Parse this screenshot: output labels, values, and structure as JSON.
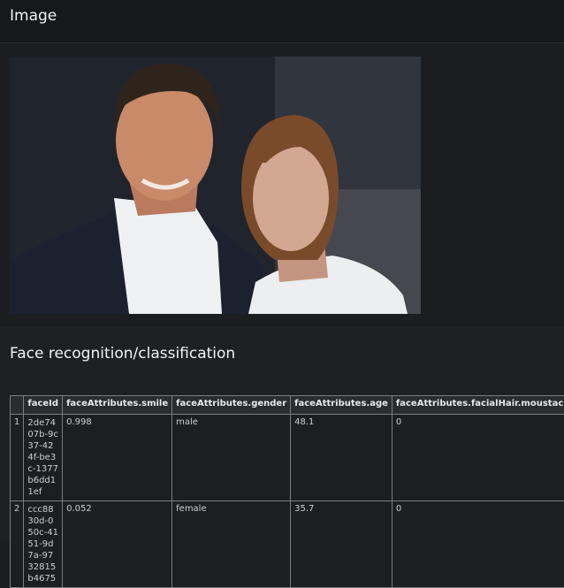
{
  "image_section": {
    "title": "Image"
  },
  "photo": {
    "description_icon": "portrait-photo"
  },
  "face_section": {
    "title": "Face recognition/classification"
  },
  "table": {
    "columns": [
      "faceId",
      "faceAttributes.smile",
      "faceAttributes.gender",
      "faceAttributes.age",
      "faceAttributes.facialHair.moustache"
    ],
    "rows": [
      {
        "index": "1",
        "faceId": "2de7407b-9c37-424f-be3c-1377b6dd11ef",
        "smile": "0.998",
        "gender": "male",
        "age": "48.1",
        "moustache": "0"
      },
      {
        "index": "2",
        "faceId": "ccc8830d-050c-4151-9d7a-9732815b4675",
        "smile": "0.052",
        "gender": "female",
        "age": "35.7",
        "moustache": "0"
      }
    ]
  }
}
